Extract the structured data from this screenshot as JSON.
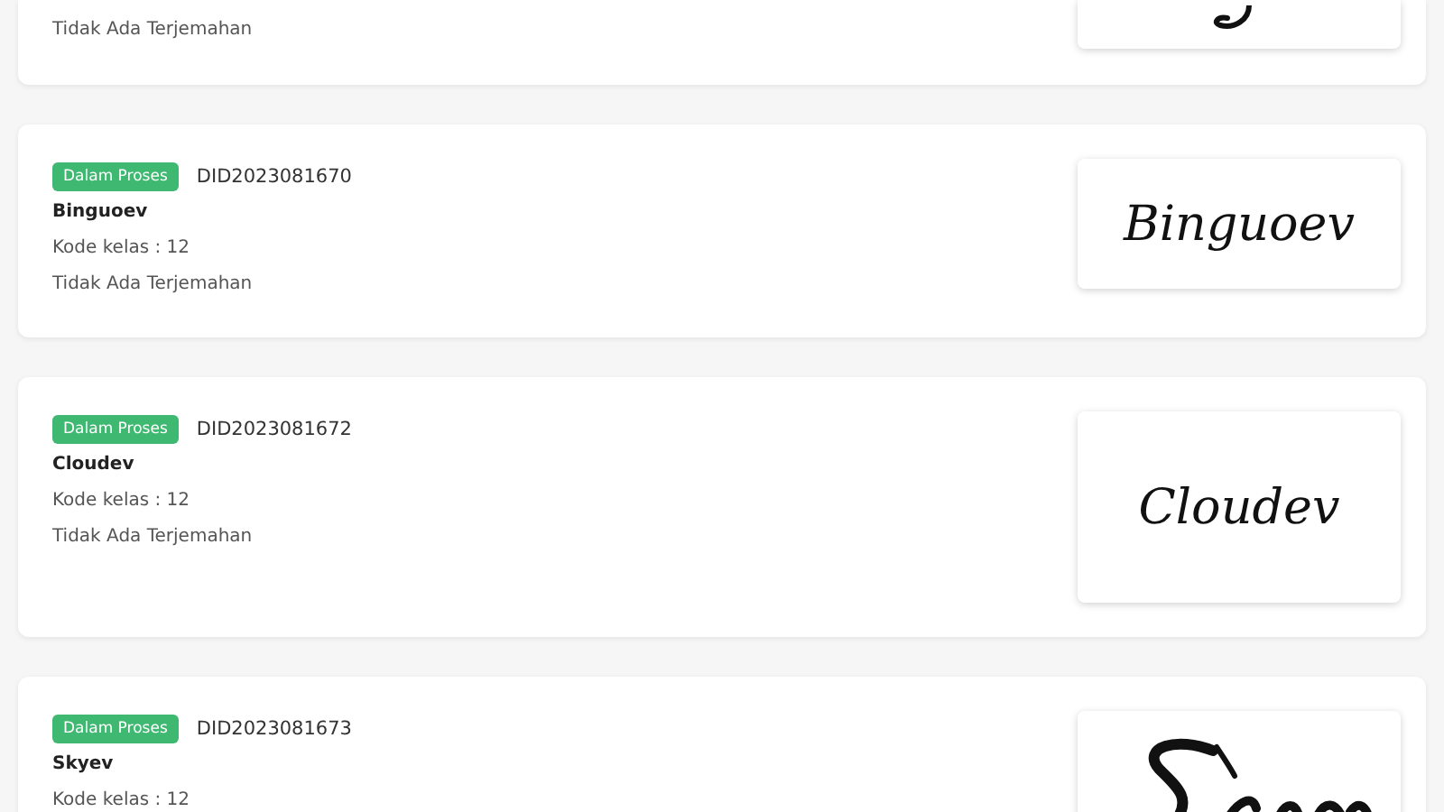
{
  "cards": [
    {
      "kind": "cut",
      "note": "Tidak Ada Terjemahan",
      "logo": {
        "kind": "fragment"
      }
    },
    {
      "kind": "full",
      "status": "Dalam Proses",
      "id": "DID2023081670",
      "name": "Binguoev",
      "class_code": "Kode kelas : 12",
      "note": "Tidak Ada Terjemahan",
      "logo": {
        "kind": "text",
        "text": "Binguoev",
        "tall": false
      }
    },
    {
      "kind": "full",
      "status": "Dalam Proses",
      "id": "DID2023081672",
      "name": "Cloudev",
      "class_code": "Kode kelas : 12",
      "note": "Tidak Ada Terjemahan",
      "logo": {
        "kind": "text",
        "text": "Cloudev",
        "tall": true
      }
    },
    {
      "kind": "full",
      "status": "Dalam Proses",
      "id": "DID2023081673",
      "name": "Skyev",
      "class_code": "Kode kelas : 12",
      "logo": {
        "kind": "cutdrawing"
      }
    }
  ]
}
